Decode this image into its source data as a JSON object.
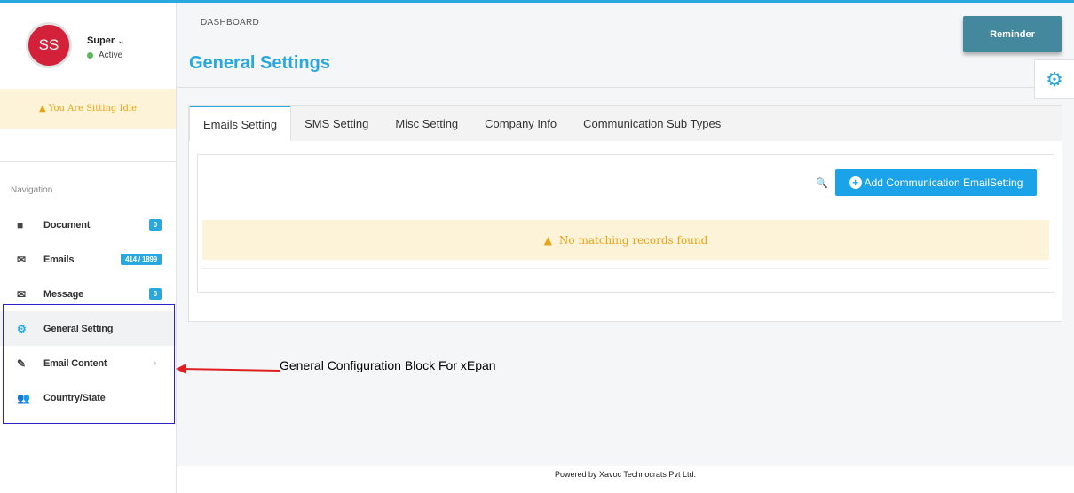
{
  "user": {
    "initials": "SS",
    "name": "Super",
    "status": "Active"
  },
  "idle_message": "You Are Sitting Idle",
  "nav": {
    "heading": "Navigation",
    "items": [
      {
        "label": "Document",
        "icon": "folder-icon",
        "badge": "0"
      },
      {
        "label": "Emails",
        "icon": "envelope-icon",
        "badge": "414 / 1899"
      },
      {
        "label": "Message",
        "icon": "envelope-icon",
        "badge": "0"
      },
      {
        "label": "General Setting",
        "icon": "gear-icon"
      },
      {
        "label": "Email Content",
        "icon": "edit-icon"
      },
      {
        "label": "Country/State",
        "icon": "users-icon"
      }
    ]
  },
  "header": {
    "breadcrumb": "DASHBOARD",
    "title": "General Settings",
    "reminder_label": "Reminder"
  },
  "tabs": [
    "Emails Setting",
    "SMS Setting",
    "Misc Setting",
    "Company Info",
    "Communication Sub Types"
  ],
  "grid": {
    "add_button": "Add Communication EmailSetting",
    "empty_message": "No matching records found"
  },
  "footer": "Powered by Xavoc Technocrats Pvt Ltd.",
  "annotation": "General Configuration Block For xEpan",
  "colors": {
    "accent": "#29a8e0",
    "avatar": "#d3213a",
    "warning_bg": "#fcf3d9",
    "warning_text": "#e8a413",
    "reminder": "#44889e",
    "highlight_box": "#2a23c7",
    "arrow": "#e02020"
  }
}
